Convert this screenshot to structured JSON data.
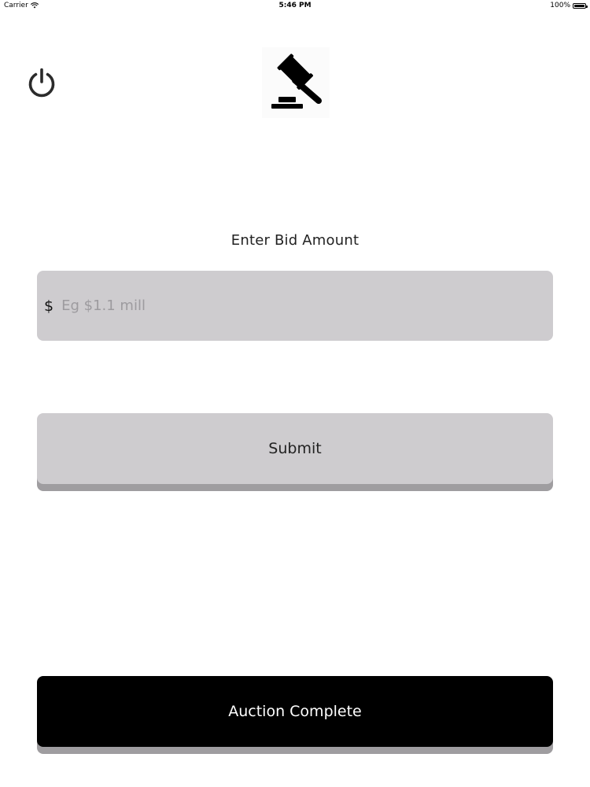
{
  "status_bar": {
    "carrier": "Carrier",
    "time": "5:46 PM",
    "battery_percent": "100%",
    "battery_level": 1.0
  },
  "header": {
    "power_icon": "power-icon",
    "logo_icon": "gavel-icon"
  },
  "bid": {
    "label": "Enter Bid Amount",
    "currency_symbol": "$",
    "placeholder": "Eg $1.1 mill",
    "value": ""
  },
  "actions": {
    "submit_label": "Submit",
    "complete_label": "Auction Complete"
  },
  "colors": {
    "field_background": "#cecccf",
    "button_shadow": "#9f9da0",
    "complete_background": "#000000"
  }
}
